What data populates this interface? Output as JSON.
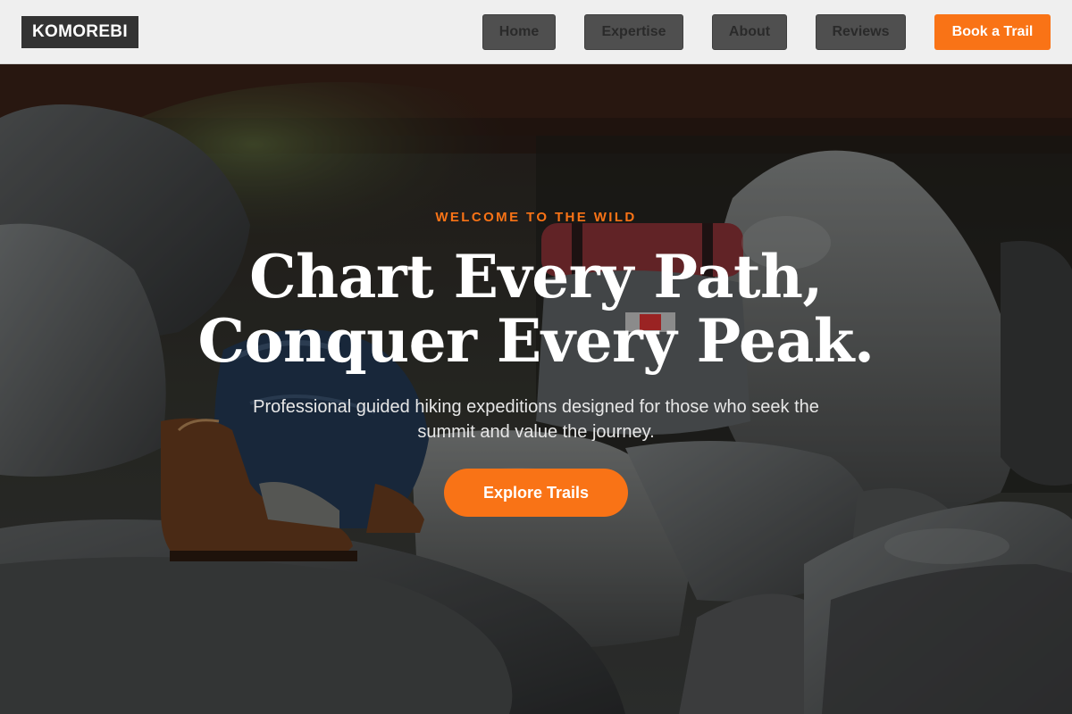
{
  "header": {
    "logo": "KOMOREBI",
    "nav": {
      "home": "Home",
      "expertise": "Expertise",
      "about": "About",
      "reviews": "Reviews"
    },
    "cta_label": "Book a Trail"
  },
  "hero": {
    "eyebrow": "WELCOME TO THE WILD",
    "headline_line1": "Chart Every Path,",
    "headline_line2": "Conquer Every Peak.",
    "subtext": "Professional guided hiking expeditions designed for those who seek the summit and value the journey.",
    "cta_label": "Explore Trails"
  },
  "colors": {
    "accent": "#f97316",
    "header_bg": "#efefef",
    "nav_button_bg": "#4f4f4f",
    "logo_bg": "#333333"
  }
}
